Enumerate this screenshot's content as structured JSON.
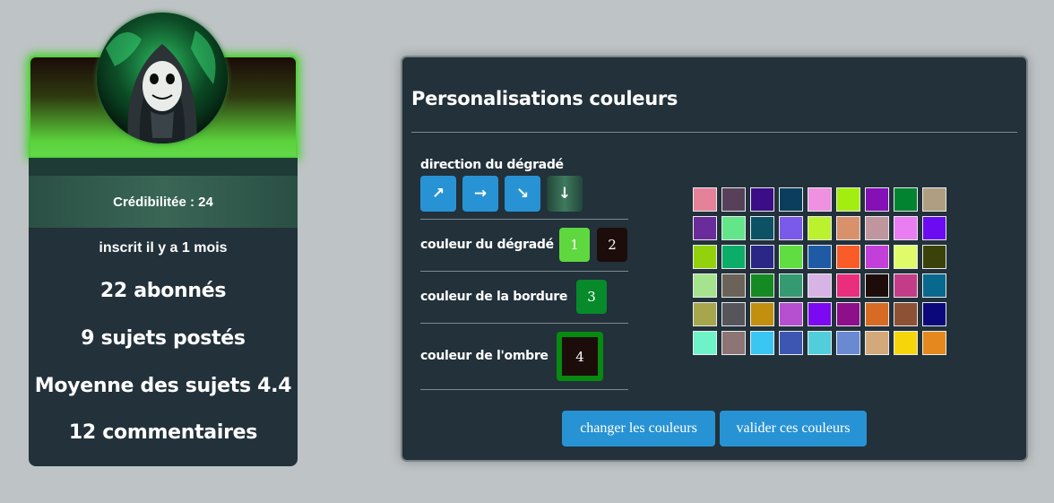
{
  "profile": {
    "credibility": "Crédibilitée : 24",
    "registered": "inscrit il y a 1 mois",
    "stats": [
      "22 abonnés",
      "9 sujets postés",
      "Moyenne des sujets 4.4",
      "12 commentaires"
    ],
    "banner_colors": {
      "top": "#1b0b08",
      "bottom": "#63d84a",
      "glow": "#4fd23a"
    }
  },
  "panel": {
    "title": "Personalisations couleurs",
    "direction_label": "direction du dégradé",
    "direction_buttons": [
      {
        "icon": "arrow-up-right-icon",
        "glyph": "↗"
      },
      {
        "icon": "arrow-right-icon",
        "glyph": "→"
      },
      {
        "icon": "arrow-down-right-icon",
        "glyph": "↘"
      },
      {
        "icon": "arrow-down-icon",
        "glyph": "↓"
      }
    ],
    "gradient_label": "couleur du dégradé",
    "gradient_color_1": {
      "text": "1",
      "color": "#5fd83f"
    },
    "gradient_color_2": {
      "text": "2",
      "color": "#1d0d0a"
    },
    "border_label": "couleur de la bordure",
    "border_color": {
      "text": "3",
      "color": "#078a2a"
    },
    "shadow_label": "couleur de l'ombre",
    "shadow_color": {
      "text": "4",
      "color": "#1d0d0a",
      "ring": "#078a10"
    },
    "palette": [
      "#e6819a",
      "#58405a",
      "#3b0d86",
      "#0b3e5c",
      "#ef90e0",
      "#a4ee0f",
      "#8410b6",
      "#028330",
      "#b09e81",
      "#6a2c9b",
      "#63e58a",
      "#0d5165",
      "#7a5ae8",
      "#bcf12d",
      "#d9916b",
      "#bf969e",
      "#e97df1",
      "#6b0bf1",
      "#93d10c",
      "#0cad68",
      "#2b2786",
      "#5fdd41",
      "#1f5ba4",
      "#fa5c28",
      "#c33fd9",
      "#e0fb69",
      "#3b4209",
      "#a5e38f",
      "#6b6359",
      "#168a22",
      "#349a72",
      "#d8b3e5",
      "#e82e7d",
      "#1d0d0a",
      "#c33c87",
      "#09688d",
      "#a7a64c",
      "#56555c",
      "#c28f0f",
      "#b64fd0",
      "#7c09f1",
      "#8d0f8a",
      "#d86b23",
      "#8d5136",
      "#0a087b",
      "#6ef2c8",
      "#8d7475",
      "#3ac6f2",
      "#3c56b2",
      "#51cddc",
      "#6989d2",
      "#d4a97a",
      "#f6d60a",
      "#e5891f"
    ],
    "change_button": "changer les couleurs",
    "validate_button": "valider ces couleurs"
  }
}
